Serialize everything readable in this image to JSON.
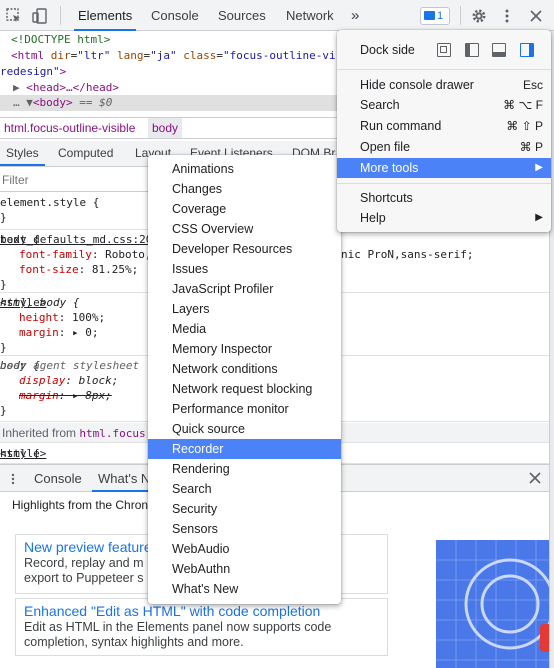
{
  "toolbar": {
    "tabs": [
      "Elements",
      "Console",
      "Sources",
      "Network"
    ],
    "more": "»",
    "issues_count": "1"
  },
  "tree": {
    "doctype": "<!DOCTYPE html>",
    "html_open": "<html ",
    "html_attr1": "dir",
    "html_val1": "\"ltr\"",
    "html_attr2": "lang",
    "html_val2": "\"ja\"",
    "html_attr3": "class",
    "html_val3": "\"focus-outline-vi",
    "redesign": "redesign\"",
    "head": "<head>…</head>",
    "body": "<body>",
    "body_eq": " == $0"
  },
  "breadcrumbs": [
    "html.focus-outline-visible",
    "body"
  ],
  "styles_tabs": [
    "Styles",
    "Computed",
    "Layout",
    "Event Listeners",
    "DOM Br"
  ],
  "filter_placeholder": "Filter",
  "rules": {
    "element_style": "element.style {",
    "close": "}",
    "body_selector": "body {",
    "body_src": "text_defaults_md.css:20",
    "font_family_prop": "font-family",
    "font_family_val": "Roboto,",
    "font_family_tail": "nic ProN,sans-serif;",
    "font_size_prop": "font-size",
    "font_size_val": "81.25%;",
    "htmlbody_selector": "html, body {",
    "htmlbody_src": "<style>",
    "height_prop": "height",
    "height_val": "100%;",
    "margin_prop": "margin",
    "margin_val": "0;",
    "ua_body_selector": "body {",
    "ua_src": "user agent stylesheet",
    "display_prop": "display",
    "display_val": "block;",
    "ua_margin_prop": "margin",
    "ua_margin_val": "8px;",
    "inherited_label": "Inherited from ",
    "inherited_from": "html.focus",
    "html_selector": "html {",
    "html_src": "<style>"
  },
  "left_menu": {
    "items": [
      "Animations",
      "Changes",
      "Coverage",
      "CSS Overview",
      "Developer Resources",
      "Issues",
      "JavaScript Profiler",
      "Layers",
      "Media",
      "Memory Inspector",
      "Network conditions",
      "Network request blocking",
      "Performance monitor",
      "Quick source",
      "Recorder",
      "Rendering",
      "Search",
      "Security",
      "Sensors",
      "WebAudio",
      "WebAuthn",
      "What's New"
    ],
    "highlighted": "Recorder"
  },
  "right_menu": {
    "dock_side": "Dock side",
    "hide_console": "Hide console drawer",
    "hide_console_sc": "Esc",
    "search": "Search",
    "search_sc": "⌘ ⌥ F",
    "run_command": "Run command",
    "run_command_sc": "⌘ ⇧ P",
    "open_file": "Open file",
    "open_file_sc": "⌘ P",
    "more_tools": "More tools",
    "arrow": "▶",
    "shortcuts": "Shortcuts",
    "help": "Help"
  },
  "drawer": {
    "tabs": [
      "Console",
      "What's N"
    ],
    "highlights": "Highlights from the Chron",
    "card1_title": "New preview feature",
    "card1_desc1": "Record, replay and m",
    "card1_desc2": "export to Puppeteer s",
    "card2_title": "Enhanced \"Edit as HTML\" with code completion",
    "card2_desc1": "Edit as HTML in the Elements panel now supports code",
    "card2_desc2": "completion, syntax highlights and more."
  },
  "colors": {
    "accent": "#1a73e8",
    "highlight": "#4c82f7",
    "tag": "#881280",
    "property": "#c80000"
  }
}
